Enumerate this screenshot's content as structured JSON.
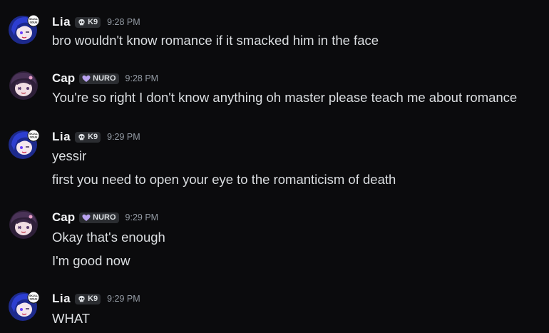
{
  "messages": [
    {
      "author": "Lia",
      "tag": "K9",
      "tag_icon": "skull-icon",
      "time": "9:28 PM",
      "avatar_badge": "SKULL ISSUE",
      "lines": [
        "bro wouldn't know romance if it smacked him in the face"
      ]
    },
    {
      "author": "Cap",
      "tag": "NURO",
      "tag_icon": "heart-icon",
      "time": "9:28 PM",
      "lines": [
        "You're so right I don't know anything oh master please teach me about romance"
      ]
    },
    {
      "author": "Lia",
      "tag": "K9",
      "tag_icon": "skull-icon",
      "time": "9:29 PM",
      "avatar_badge": "SKULL ISSUE",
      "lines": [
        "yessir",
        "first you need to open your eye to the romanticism of death"
      ]
    },
    {
      "author": "Cap",
      "tag": "NURO",
      "tag_icon": "heart-icon",
      "time": "9:29 PM",
      "lines": [
        "Okay that's enough",
        "I'm good now"
      ]
    },
    {
      "author": "Lia",
      "tag": "K9",
      "tag_icon": "skull-icon",
      "time": "9:29 PM",
      "avatar_badge": "SKULL ISSUE",
      "lines": [
        "WHAT"
      ]
    }
  ],
  "colors": {
    "background": "#0b0b0d",
    "username": "#f2f3f5",
    "message_text": "#dbdee1",
    "timestamp": "#949ba4",
    "tag_background": "#2b2d31",
    "nuro_heart": "#b9a2f0"
  }
}
